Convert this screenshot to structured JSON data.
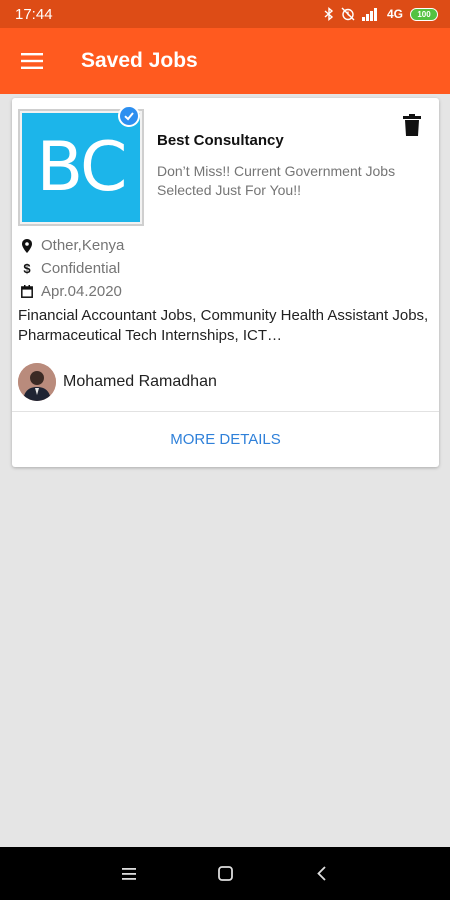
{
  "status": {
    "time": "17:44",
    "network": "4G",
    "battery": "100"
  },
  "header": {
    "title": "Saved Jobs",
    "menu_icon": "hamburger-icon"
  },
  "job": {
    "logo_text": "BC",
    "company": "Best Consultancy",
    "description": "Don’t Miss!! Current Government Jobs Selected Just For You!!",
    "location": "Other,Kenya",
    "salary": "Confidential",
    "date": "Apr.04.2020",
    "categories": "Financial Accountant Jobs, Community Health Assistant Jobs, Pharmaceutical Tech Internships, ICT…",
    "poster": "Mohamed Ramadhan",
    "more_label": "MORE DETAILS"
  },
  "colors": {
    "status_bar": "#dd4c16",
    "app_bar": "#ff5a1f",
    "logo_bg": "#1cb5ea",
    "link": "#2f80d9",
    "verified": "#2c8ff0"
  }
}
